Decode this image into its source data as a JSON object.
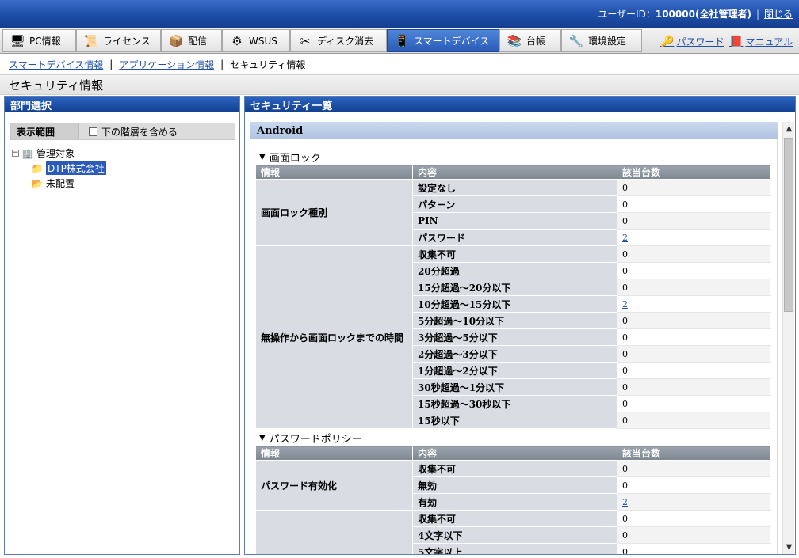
{
  "header": {
    "user_label": "ユーザーID：",
    "user_id": "100000(全社管理者)",
    "close_label": "閉じる"
  },
  "menu": {
    "tabs": [
      {
        "label": "PC情報",
        "icon": "pc-icon"
      },
      {
        "label": "ライセンス",
        "icon": "license-icon"
      },
      {
        "label": "配信",
        "icon": "delivery-icon"
      },
      {
        "label": "WSUS",
        "icon": "wsus-icon"
      },
      {
        "label": "ディスク消去",
        "icon": "disk-erase-icon"
      },
      {
        "label": "スマートデバイス",
        "icon": "smart-device-icon"
      },
      {
        "label": "台帳",
        "icon": "ledger-icon"
      },
      {
        "label": "環境設定",
        "icon": "settings-icon"
      }
    ],
    "active_tab": "スマートデバイス",
    "password_link": "パスワード",
    "manual_link": "マニュアル"
  },
  "subnav": {
    "items": [
      "スマートデバイス情報",
      "アプリケーション情報",
      "セキュリティ情報"
    ]
  },
  "page_title": "セキュリティ情報",
  "left_panel": {
    "title": "部門選択",
    "scope_label": "表示範囲",
    "include_label": "下の階層を含める",
    "tree": [
      "管理対象",
      "DTP株式会社",
      "未配置"
    ]
  },
  "right_panel": {
    "title": "セキュリティ一覧",
    "os": "Android",
    "col_info": "情報",
    "col_content": "内容",
    "col_count": "該当台数",
    "sections": [
      {
        "title": "画面ロック",
        "groups": [
          {
            "label": "画面ロック種別",
            "rows": [
              [
                "設定なし",
                "0"
              ],
              [
                "パターン",
                "0"
              ],
              [
                "PIN",
                "0"
              ],
              [
                "パスワード",
                "2"
              ]
            ]
          },
          {
            "label": "無操作から画面ロックまでの時間",
            "rows": [
              [
                "収集不可",
                "0"
              ],
              [
                "20分超過",
                "0"
              ],
              [
                "15分超過～20分以下",
                "0"
              ],
              [
                "10分超過～15分以下",
                "2"
              ],
              [
                "5分超過～10分以下",
                "0"
              ],
              [
                "3分超過～5分以下",
                "0"
              ],
              [
                "2分超過～3分以下",
                "0"
              ],
              [
                "1分超過～2分以下",
                "0"
              ],
              [
                "30秒超過～1分以下",
                "0"
              ],
              [
                "15秒超過～30秒以下",
                "0"
              ],
              [
                "15秒以下",
                "0"
              ]
            ]
          }
        ]
      },
      {
        "title": "パスワードポリシー",
        "groups": [
          {
            "label": "パスワード有効化",
            "rows": [
              [
                "収集不可",
                "0"
              ],
              [
                "無効",
                "0"
              ],
              [
                "有効",
                "2"
              ]
            ]
          },
          {
            "label": "",
            "rows": [
              [
                "収集不可",
                "0"
              ],
              [
                "4文字以下",
                "0"
              ],
              [
                "5文字以上",
                "0"
              ]
            ]
          }
        ]
      }
    ]
  }
}
